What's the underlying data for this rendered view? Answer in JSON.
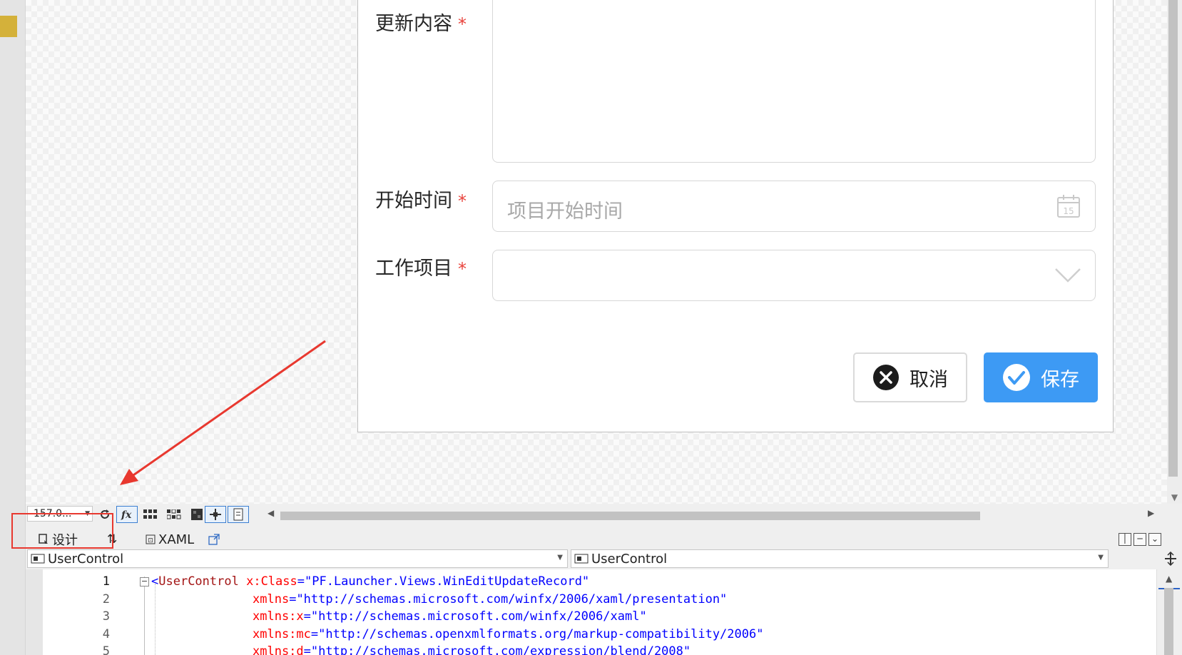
{
  "form": {
    "update_content_label": "更新内容",
    "start_time_label": "开始时间",
    "start_time_placeholder": "项目开始时间",
    "work_item_label": "工作项目",
    "required_mark": "*",
    "calendar_day": "15",
    "cancel_label": "取消",
    "save_label": "保存"
  },
  "designer": {
    "zoom_value": "157.0...",
    "design_tab": "设计",
    "swap_icon": "⇅",
    "xaml_tab": "XAML",
    "left_combo": "UserControl",
    "right_combo": "UserControl"
  },
  "code": {
    "line_numbers": [
      "1",
      "2",
      "3",
      "4",
      "5"
    ],
    "line1_tag": "UserControl",
    "line1_attr": "x:Class",
    "line1_value": "\"PF.Launcher.Views.WinEditUpdateRecord\"",
    "line2_attr": "xmlns",
    "line2_value": "\"http://schemas.microsoft.com/winfx/2006/xaml/presentation\"",
    "line3_attr": "xmlns:x",
    "line3_value": "\"http://schemas.microsoft.com/winfx/2006/xaml\"",
    "line4_attr": "xmlns:mc",
    "line4_value": "\"http://schemas.openxmlformats.org/markup-compatibility/2006\"",
    "line5_attr": "xmlns:d",
    "line5_value": "\"http://schemas.microsoft.com/expression/blend/2008\""
  },
  "colors": {
    "accent_blue": "#3d9af4",
    "required_red": "#e8433c",
    "annotation_red": "#e8382f"
  },
  "icons": [
    "calendar-icon",
    "chevron-down-icon",
    "close-circle-icon",
    "check-circle-icon",
    "refresh-icon",
    "fx-icon",
    "grid-icon",
    "snap-grid-icon",
    "artboard-icon",
    "snap-lines-icon",
    "page-icon",
    "design-icon",
    "swap-icon",
    "xaml-icon",
    "popout-icon",
    "split-vertical-icon",
    "split-horizontal-icon",
    "collapse-pane-icon",
    "usercontrol-icon",
    "add-split-icon"
  ]
}
